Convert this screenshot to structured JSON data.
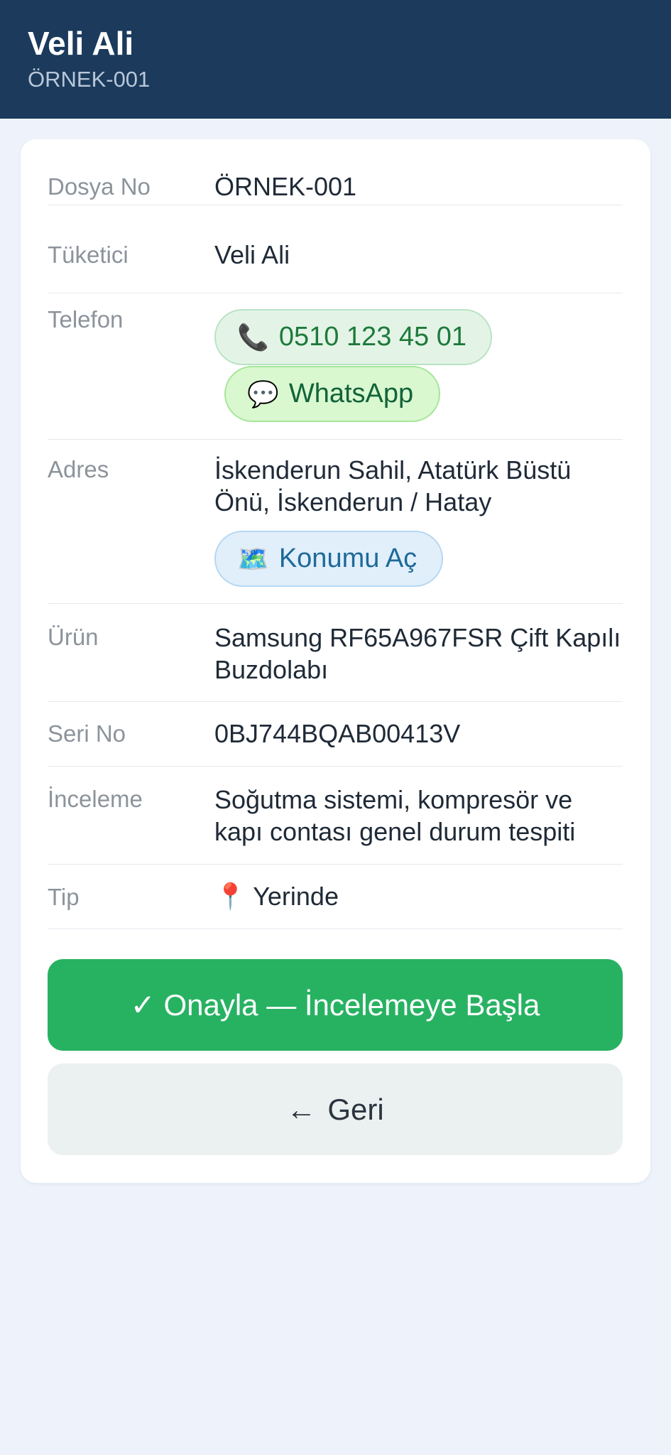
{
  "header": {
    "title": "Veli Ali",
    "subtitle": "ÖRNEK-001"
  },
  "details": {
    "file_no": {
      "label": "Dosya No",
      "value": "ÖRNEK-001"
    },
    "customer": {
      "label": "Tüketici",
      "value": "Veli Ali"
    },
    "phone": {
      "label": "Telefon",
      "number": "0510 123 45 01",
      "phone_icon": "📞",
      "whatsapp_label": "WhatsApp",
      "whatsapp_icon": "💬"
    },
    "address": {
      "label": "Adres",
      "value": "İskenderun Sahil, Atatürk Büstü Önü, İskenderun / Hatay",
      "map_button": "Konumu Aç",
      "map_icon": "🗺️"
    },
    "product": {
      "label": "Ürün",
      "value": "Samsung RF65A967FSR Çift Kapılı Buzdolabı"
    },
    "serial": {
      "label": "Seri No",
      "value": "0BJ744BQAB00413V"
    },
    "inspection": {
      "label": "İnceleme",
      "value": "Soğutma sistemi, kompresör ve kapı contası genel durum tespiti"
    },
    "type": {
      "label": "Tip",
      "value": "Yerinde",
      "icon": "📍"
    }
  },
  "actions": {
    "confirm": "✓ Onayla — İncelemeye Başla",
    "back_arrow": "←",
    "back": "Geri"
  },
  "colors": {
    "header_bg": "#1b3a5c",
    "page_bg": "#eef3fb",
    "primary_green": "#27b262",
    "secondary_bg": "#ebf0f0"
  }
}
